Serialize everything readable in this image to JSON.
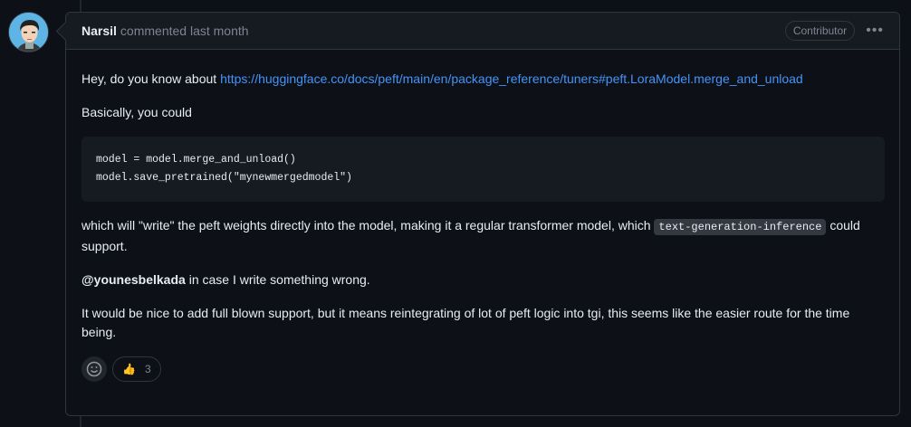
{
  "comment": {
    "author": "Narsil",
    "meta": "commented last month",
    "badge": "Contributor",
    "more_icon": "kebab-horizontal-icon",
    "intro": "Hey, do you know about ",
    "link": "https://huggingface.co/docs/peft/main/en/package_reference/tuners#peft.LoraModel.merge_and_unload",
    "para2": "Basically, you could",
    "code_lines": [
      "model = model.merge_and_unload()",
      "model.save_pretrained(\"mynewmergedmodel\")"
    ],
    "para3_before": "which will \"write\" the peft weights directly into the model, making it a regular transformer model, which ",
    "para3_code": "text-generation-inference",
    "para3_after": " could support.",
    "mention": "@younesbelkada",
    "para4_after": " in case I write something wrong.",
    "para5": "It would be nice to add full blown support, but it means reintegrating of lot of peft logic into tgi, this seems like the easier route for the time being."
  },
  "reactions": {
    "add_icon": "smiley-icon",
    "items": [
      {
        "emoji": "👍",
        "count": "3"
      }
    ]
  }
}
